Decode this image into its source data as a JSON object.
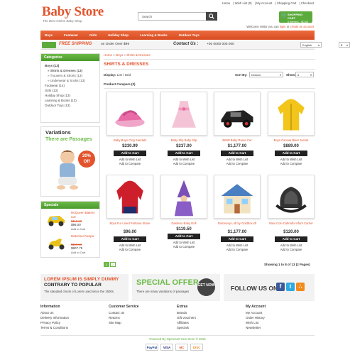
{
  "header": {
    "logo_title": "Baby Store",
    "logo_subtitle": "The Best Online Baby Shop",
    "toplinks": [
      "Home",
      "| Wish List (0)",
      "| My Account",
      "| Shopping Cart",
      "| Checkout"
    ],
    "search_placeholder": "Search",
    "cart_title": "SHOPPING CART",
    "cart_summary": "0 item(s) - $0.00",
    "welcome_text": "Welcome visitor you can",
    "login_link": "login",
    "or_text": "or",
    "register_link": "create an account"
  },
  "nav": [
    "Boys",
    "Footwear",
    "Girls",
    "Holiday Shop",
    "Learning & Books",
    "Outdoor Toys"
  ],
  "shipbar": {
    "free_shipping": "FREE SHIPPING",
    "order_text": "on Order Over $99",
    "contact_label": "Contact Us :",
    "phone": "+00 0000 000 000",
    "language": "English",
    "currency": "$"
  },
  "sidebar": {
    "categories_title": "Categories",
    "categories": [
      {
        "label": "Boys (13)",
        "level": 0,
        "selected": true
      },
      {
        "label": "» Shirts & Dresses (13)",
        "level": 1,
        "selected": true
      },
      {
        "label": "» Trousers & Shorts (13)",
        "level": 1,
        "selected": false
      },
      {
        "label": "» Underwear & Socks (13)",
        "level": 1,
        "selected": false
      },
      {
        "label": "Footwear (14)",
        "level": 0,
        "selected": false
      },
      {
        "label": "Girls (13)",
        "level": 0,
        "selected": false
      },
      {
        "label": "Holiday Shop (13)",
        "level": 0,
        "selected": false
      },
      {
        "label": "Learning & Books (13)",
        "level": 0,
        "selected": false
      },
      {
        "label": "Outdoor Toys (13)",
        "level": 0,
        "selected": false
      }
    ],
    "variations_title": "Variations",
    "variations_sub": "There are Passages",
    "offer_pct": "20%",
    "offer_label": "Off",
    "specials_title": "Specials",
    "specials": [
      {
        "name": "McQueen Battery Car",
        "old_price": "$119.50",
        "new_price": "$96.00",
        "add": "Add to Cart"
      },
      {
        "name": "Motorised Vespa",
        "old_price": "$119.50",
        "new_price": "$907.75",
        "add": "Add to Cart"
      }
    ]
  },
  "main": {
    "breadcrumb": [
      "Home",
      "Boys",
      "Shirts & Dresses"
    ],
    "breadcrumb_sep": "»",
    "title": "SHIRTS & DRESSES",
    "display_label": "Display:",
    "display_list": "List",
    "display_grid": "Grid",
    "sort_label": "Sort By:",
    "sort_value": "Default",
    "show_label": "Show:",
    "show_value": "6",
    "compare": "Product Compare (0)",
    "add_to_cart": "Add to Cart",
    "add_to_wishlist": "Add to Wish List",
    "add_to_compare": "Add to Compare",
    "products": [
      {
        "name": "Baby Boys Clog Sandals",
        "price": "$230.99",
        "icon": "sandal-icon"
      },
      {
        "name": "Baby Slip Baby Slip",
        "price": "$237.00",
        "icon": "dress-icon"
      },
      {
        "name": "BMW Baby Racer Car",
        "price": "$1,177.00",
        "icon": "racer-car-icon"
      },
      {
        "name": "Boys Canvas Biker Jacket",
        "price": "$889.00",
        "icon": "rain-jacket-icon"
      },
      {
        "name": "Boys Fur Lined Parkana Stone",
        "price": "$96.00",
        "icon": "red-coat-icon"
      },
      {
        "name": "Dasheru Baby Doll",
        "price": "$119.50",
        "icon": "wizard-doll-icon"
      },
      {
        "name": "Discovery Loft by Goldbox.sft",
        "price": "$1,177.00",
        "icon": "dollhouse-icon"
      },
      {
        "name": "Maxi Cosi Cabriofix Infant Carrier",
        "price": "$120.00",
        "icon": "car-seat-icon"
      }
    ],
    "pages": [
      "1",
      "2"
    ],
    "showing": "Showing 1 to 8 of 13 (2 Pages)"
  },
  "promos": {
    "lorem1": "LOREM IPSUM IS SIMPLY DUMMY",
    "lorem2": "CONTRARY TO POPULAR",
    "lorem3": "The standard chunk of Lorem used since the 1500s",
    "special": "SPECIAL OFFER",
    "special_sub": "There are many variations of passages",
    "get_now": "GET NOW",
    "follow": "FOLLOW US ON"
  },
  "footer": {
    "columns": [
      {
        "title": "Information",
        "items": [
          "About Us",
          "Delivery Information",
          "Privacy Policy",
          "Terms & Conditions"
        ]
      },
      {
        "title": "Customer Service",
        "items": [
          "Contact Us",
          "Returns",
          "Site Map"
        ]
      },
      {
        "title": "Extras",
        "items": [
          "Brands",
          "Gift Vouchers",
          "Affiliates",
          "Specials"
        ]
      },
      {
        "title": "My Account",
        "items": [
          "My Account",
          "Order History",
          "Wish List",
          "Newsletter"
        ]
      }
    ],
    "powered": "Powered By OpenCart Your Store © 2015",
    "payments": [
      "PayPal",
      "VISA",
      "MC",
      "DISC"
    ]
  },
  "colors": {
    "accent": "#e2542d",
    "green": "#6cba47",
    "dark": "#222222"
  }
}
